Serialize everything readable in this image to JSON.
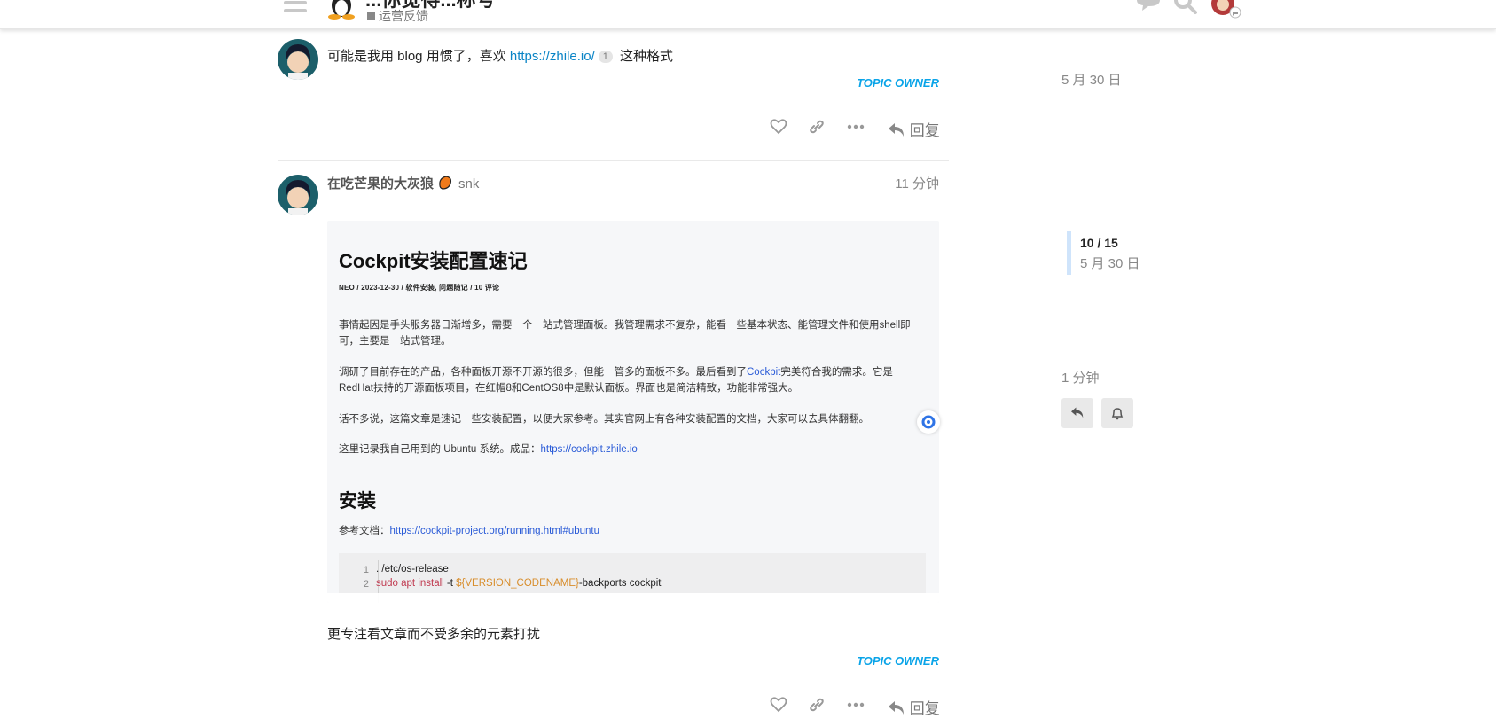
{
  "header": {
    "topic_title": "...你觉得...称号",
    "category": "运营反馈",
    "icons": [
      "hamburger-icon",
      "site-logo",
      "chat-icon",
      "search-icon",
      "user-avatar"
    ]
  },
  "posts": [
    {
      "text_before": "可能是我用 blog 用惯了，喜欢 ",
      "link": "https://zhile.io/",
      "link_clicks": "1",
      "text_after": " 这种格式",
      "badge": "TOPIC OWNER",
      "reply_label": "回复"
    },
    {
      "username": "在吃芒果的大灰狼",
      "alt_name": "snk",
      "date": "11 分钟",
      "onebox": {
        "title": "Cockpit安装配置速记",
        "meta": "NEO  /  2023-12-30  /  软件安装, 问题随记  /  10 评论",
        "p1": "事情起因是手头服务器日渐增多，需要一个一站式管理面板。我管理需求不复杂，能看一些基本状态、能管理文件和使用shell即可，主要是一站式管理。",
        "p2_before": "调研了目前存在的产品，各种面板开源不开源的很多，但能一管多的面板不多。最后看到了",
        "p2_link": "Cockpit",
        "p2_after": "完美符合我的需求。它是RedHat扶持的开源面板项目，在红帽8和CentOS8中是默认面板。界面也是简洁精致，功能非常强大。",
        "p3": "话不多说，这篇文章是速记一些安装配置，以便大家参考。其实官网上有各种安装配置的文档，大家可以去具体翻翻。",
        "p4_before": "这里记录我自己用到的 Ubuntu 系统。成品：",
        "p4_link": "https://cockpit.zhile.io",
        "h2": "安装",
        "ref_label": "参考文档：",
        "ref_link": "https://cockpit-project.org/running.html#ubuntu",
        "code_line1_no": "1",
        "code_line2_no": "2",
        "code_line1": ". /etc/os-release",
        "code_line2_cmd": "sudo apt install",
        "code_line2_flag": " -t ",
        "code_line2_var": "${VERSION_CODENAME}",
        "code_line2_rest": "-backports cockpit"
      },
      "text": "更专注看文章而不受多余的元素打扰",
      "badge": "TOPIC OWNER",
      "reply_label": "回复"
    }
  ],
  "timeline": {
    "start_date": "5 月 30 日",
    "position": "10 / 15",
    "position_date": "5 月 30 日",
    "end_date": "1 分钟"
  },
  "colors": {
    "accent": "#0aa4e8",
    "link": "#0a84c6"
  }
}
